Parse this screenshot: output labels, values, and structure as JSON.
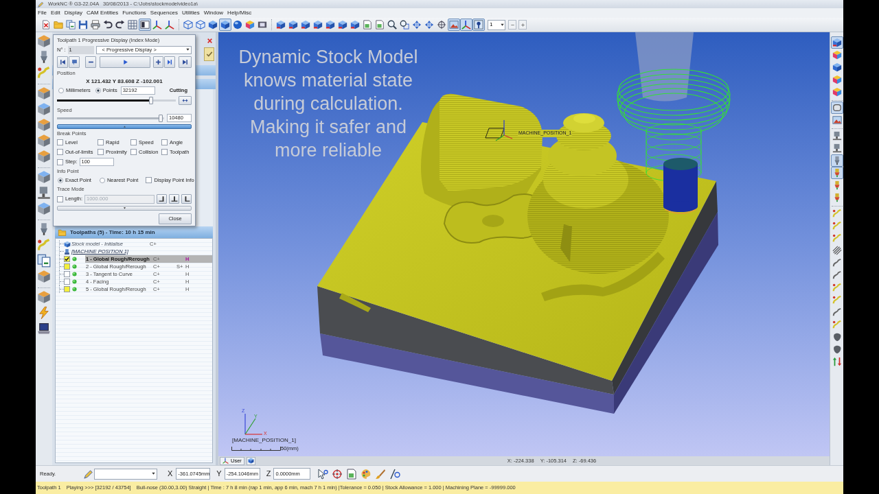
{
  "window": {
    "title": "WorkNC ® G3-22.04A   30/08/2013 - C:\\Jobs\\stockmodelvideo1a\\"
  },
  "menu": [
    "File",
    "Edit",
    "Display",
    "CAM Entities",
    "Functions",
    "Sequences",
    "Utilities",
    "Window",
    "Help/Misc"
  ],
  "main_toolbar": {
    "buttons": [
      {
        "pressed": false
      },
      {
        "pressed": false
      },
      {
        "pressed": false
      },
      {
        "pressed": false
      },
      {
        "pressed": false
      },
      {
        "pressed": false
      },
      {
        "pressed": false
      },
      {
        "pressed": false
      },
      {
        "pressed": true
      },
      {
        "pressed": false
      },
      {
        "pressed": false
      },
      {
        "pressed": false
      },
      {
        "pressed": false
      },
      {
        "pressed": false
      },
      {
        "pressed": true
      },
      {
        "pressed": false
      },
      {
        "pressed": false
      },
      {
        "pressed": false
      },
      {
        "pressed": false
      },
      {
        "pressed": false
      },
      {
        "pressed": false
      },
      {
        "pressed": false
      },
      {
        "pressed": false
      },
      {
        "pressed": false
      },
      {
        "pressed": false
      },
      {
        "pressed": false
      },
      {
        "pressed": false
      },
      {
        "pressed": false
      },
      {
        "pressed": false
      },
      {
        "pressed": false
      },
      {
        "pressed": false
      },
      {
        "pressed": false
      },
      {
        "pressed": true
      },
      {
        "pressed": true
      },
      {
        "pressed": true
      }
    ],
    "layer": "1"
  },
  "progressive_display": {
    "title": "Toolpath 1 Progressive Display (Index Mode)",
    "number_label": "N° :",
    "number": "1",
    "mode": "< Progressive Display >",
    "position_label": "Position",
    "position": "X 121.432 Y 83.608 Z -102.001",
    "units": [
      {
        "label": "Millimeters",
        "selected": false
      },
      {
        "label": "Points",
        "selected": true
      }
    ],
    "points": "32192",
    "state": "Cutting",
    "position_slider": {
      "level": 0.79
    },
    "speed_label": "Speed",
    "speed_slider": {
      "level": 0.97
    },
    "speed": "10480",
    "break_points": {
      "title": "Break Points",
      "options": [
        {
          "label": "Level",
          "checked": false
        },
        {
          "label": "Rapid",
          "checked": false
        },
        {
          "label": "Speed",
          "checked": false
        },
        {
          "label": "Angle",
          "checked": false
        },
        {
          "label": "Out-of-limits",
          "checked": false
        },
        {
          "label": "Proximity",
          "checked": false
        },
        {
          "label": "Collision",
          "checked": false
        },
        {
          "label": "Toolpath",
          "checked": false
        }
      ],
      "step_label": "Step:",
      "step_checked": false,
      "step": "100"
    },
    "info_point": {
      "title": "Info Point",
      "modes": [
        {
          "label": "Exact Point",
          "selected": true
        },
        {
          "label": "Nearest Point",
          "selected": false
        }
      ],
      "display_info": {
        "label": "Display Point Info",
        "checked": false
      }
    },
    "trace_mode": {
      "title": "Trace Mode",
      "length": {
        "label": "Length:",
        "checked": false,
        "value": "1000.000",
        "disabled": true
      }
    },
    "close": "Close"
  },
  "toolpaths_panel": {
    "header": "Toolpaths (5) - Time: 10 h 15 min",
    "items": [
      {
        "kind": "stock",
        "label": "Stock model - Initialise",
        "column_2": "C+"
      },
      {
        "kind": "machine",
        "label": "[MACHINE POSITION 1]"
      },
      {
        "kind": "toolpath",
        "label": "1 - Global Rough/Rerough",
        "checked": true,
        "color": "#f4ef3c",
        "selected": true,
        "column_2": "C+",
        "column_4": "H"
      },
      {
        "kind": "toolpath",
        "label": "2 - Global Rough/Rerough",
        "checked": false,
        "color": "#f4ef3c",
        "selected": false,
        "column_2": "C+",
        "column_3": "S+",
        "column_4": "H"
      },
      {
        "kind": "toolpath",
        "label": "3 - Tangent to Curve",
        "checked": false,
        "color": "#ffffff",
        "selected": false,
        "column_2": "C+",
        "column_4": "H"
      },
      {
        "kind": "toolpath",
        "label": "4 - Facing",
        "checked": false,
        "color": "#ffffff",
        "selected": false,
        "column_2": "C+",
        "column_4": "H"
      },
      {
        "kind": "toolpath",
        "label": "5 - Global Rough/Rerough",
        "checked": false,
        "color": "#f4ef3c",
        "selected": false,
        "column_2": "C+",
        "column_4": "H"
      }
    ]
  },
  "viewport": {
    "caption_lines": [
      "Dynamic Stock Model",
      "knows material state",
      "during calculation.",
      "Making it safer and",
      "more reliable"
    ],
    "origin_label": "MACHINE_POSITION_1",
    "axis_labels": [
      "Z",
      "Y",
      "X"
    ],
    "position_label": "[MACHINE_POSITION_1]",
    "scale": "50(mm)",
    "view_tab": "User",
    "cursor_position": [
      "X: -224.338",
      "Y: -105.314",
      "Z: -69.436"
    ]
  },
  "right_toolbar": {
    "buttons": [
      {
        "pressed": true
      },
      {
        "pressed": false
      },
      {
        "pressed": false
      },
      {
        "pressed": false
      },
      {
        "pressed": false
      },
      {
        "pressed": true
      },
      {
        "pressed": false
      },
      {
        "pressed": false
      },
      {
        "pressed": false
      },
      {
        "pressed": true
      },
      {
        "pressed": true
      },
      {
        "pressed": false
      },
      {
        "pressed": false
      },
      {
        "pressed": false
      },
      {
        "pressed": false
      },
      {
        "pressed": false
      },
      {
        "pressed": false
      },
      {
        "pressed": false
      },
      {
        "pressed": false
      },
      {
        "pressed": false
      },
      {
        "pressed": false
      },
      {
        "pressed": false
      },
      {
        "pressed": false
      },
      {
        "pressed": false
      },
      {
        "pressed": false
      },
      {
        "pressed": false
      }
    ]
  },
  "status_row": {
    "message": "Ready.",
    "x_label": "X",
    "x": "-361.0745mm",
    "y_label": "Y",
    "y": "-254.1046mm",
    "z_label": "Z",
    "z": "0.0000mm"
  },
  "status_bar": {
    "toolpath": "Toolpath 1",
    "playing": true,
    "progress": "Playing >>> [32192 / 43754]",
    "details": "Bull-nose (30.00,3.00) Straight | Time : 7 h 8 min (rap 1 min, app 6 min, mach 7 h 1 min) |Tolerance = 0.050 | Stock Allowance = 1.000 | Machining Plane = -99999.000"
  }
}
